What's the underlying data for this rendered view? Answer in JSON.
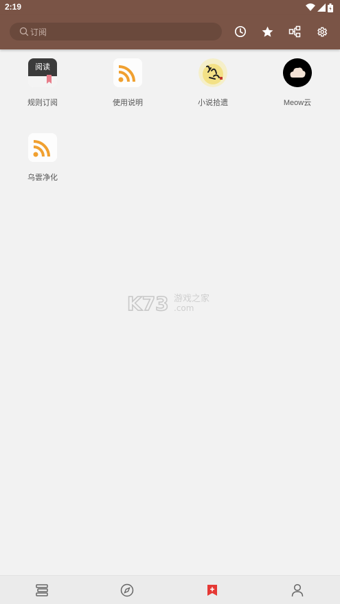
{
  "status_bar": {
    "time": "2:19"
  },
  "search": {
    "placeholder": "订阅"
  },
  "toolbar": {
    "actions": [
      "history-icon",
      "star-icon",
      "group-icon",
      "settings-icon"
    ]
  },
  "sources": [
    {
      "label": "规则订阅",
      "icon": "reading-app-icon",
      "icon_text": "阅读"
    },
    {
      "label": "使用说明",
      "icon": "rss-icon"
    },
    {
      "label": "小说拾遗",
      "icon": "calligraphy-icon"
    },
    {
      "label": "Meow云",
      "icon": "cloud-icon"
    },
    {
      "label": "乌雲净化",
      "icon": "rss-icon"
    }
  ],
  "watermark": {
    "brand": "K73",
    "text": "游戏之家",
    "domain": ".com"
  },
  "bottom_nav": {
    "items": [
      "bookshelf-icon",
      "explore-icon",
      "subscription-icon",
      "profile-icon"
    ],
    "active_index": 2
  },
  "colors": {
    "toolbar": "#7a5446",
    "background": "#f2f2f2",
    "rss_orange": "#f0a030",
    "active_nav": "#e53935"
  }
}
